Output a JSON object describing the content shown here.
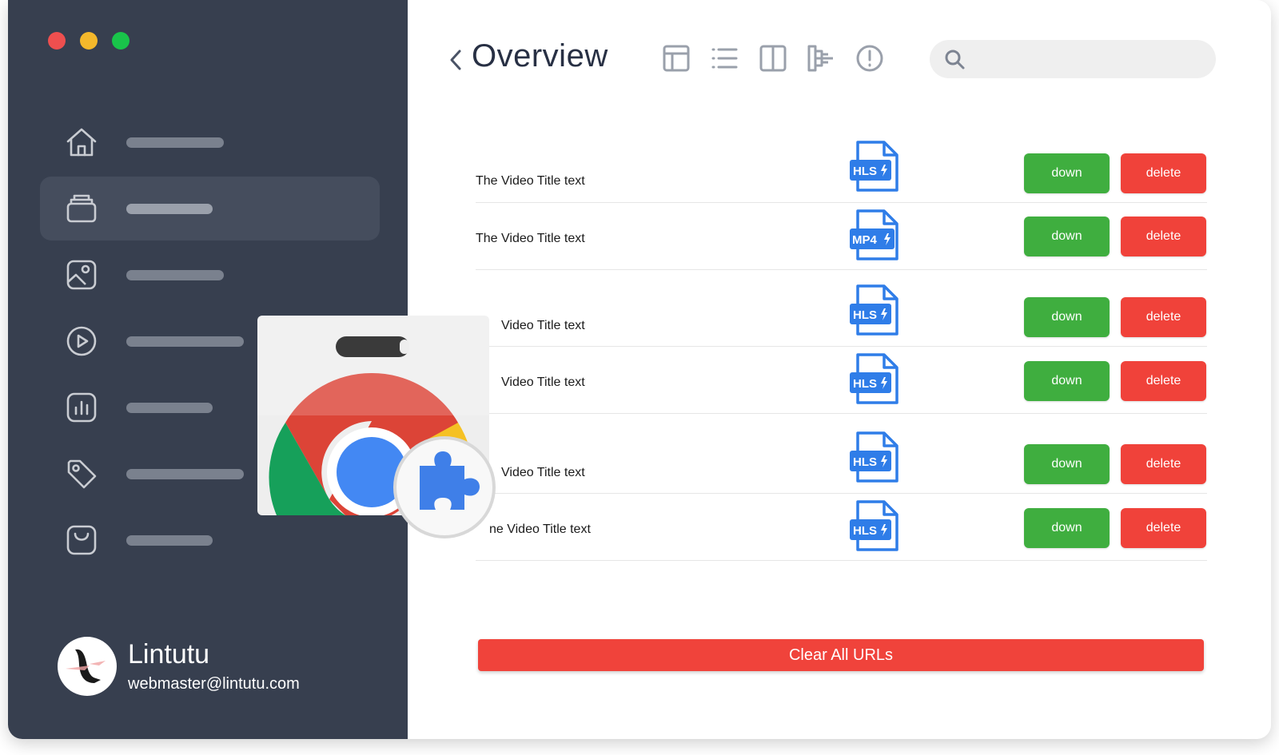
{
  "window": {
    "title": "Overview"
  },
  "profile": {
    "name": "Lintutu",
    "email": "webmaster@lintutu.com"
  },
  "sidebar": {
    "items": [
      {
        "icon": "home-icon",
        "active": false
      },
      {
        "icon": "archive-icon",
        "active": true
      },
      {
        "icon": "image-icon",
        "active": false
      },
      {
        "icon": "play-icon",
        "active": false
      },
      {
        "icon": "stats-icon",
        "active": false
      },
      {
        "icon": "tag-icon",
        "active": false
      },
      {
        "icon": "bag-icon",
        "active": false
      }
    ]
  },
  "header": {
    "title": "Overview",
    "toolbar_icons": [
      "table-icon",
      "list-icon",
      "columns-icon",
      "tree-icon",
      "alert-icon"
    ],
    "search": {
      "placeholder": "",
      "value": ""
    }
  },
  "videos": [
    {
      "title": "The Video Title text",
      "format": "HLS",
      "down_label": "down",
      "delete_label": "delete"
    },
    {
      "title": "The Video Title text",
      "format": "MP4",
      "down_label": "down",
      "delete_label": "delete"
    },
    {
      "title": "Video Title text",
      "format": "HLS",
      "down_label": "down",
      "delete_label": "delete"
    },
    {
      "title": "Video Title text",
      "format": "HLS",
      "down_label": "down",
      "delete_label": "delete"
    },
    {
      "title": "Video Title text",
      "format": "HLS",
      "down_label": "down",
      "delete_label": "delete"
    },
    {
      "title": "ne Video Title text",
      "format": "HLS",
      "down_label": "down",
      "delete_label": "delete"
    }
  ],
  "actions": {
    "clear_all_label": "Clear All URLs"
  },
  "colors": {
    "sidebar_bg": "#373f4f",
    "down_button": "#3fae3f",
    "delete_button": "#f0423a",
    "file_icon": "#2f7de8"
  }
}
